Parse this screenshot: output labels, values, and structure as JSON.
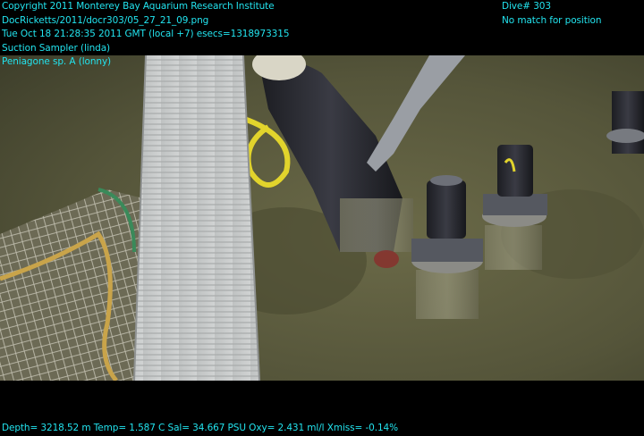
{
  "overlay": {
    "left_lines": [
      "Copyright 2011 Monterey Bay Aquarium Research Institute",
      "DocRicketts/2011/docr303/05_27_21_09.png",
      "Tue Oct 18 21:28:35 2011 GMT (local +7)  esecs=1318973315",
      "Suction Sampler (linda)",
      "Peniagone sp. A (lonny)"
    ],
    "right_lines": [
      "Dive# 303",
      "No match for position"
    ],
    "bottom_line": "Depth= 3218.52 m  Temp= 1.587 C  Sal= 34.667 PSU  Oxy= 2.431 ml/l  Xmiss= -0.14%"
  },
  "colors": {
    "overlay_text": "#22e3ee",
    "background": "#000000",
    "seafloor": "#5a5a3a"
  }
}
